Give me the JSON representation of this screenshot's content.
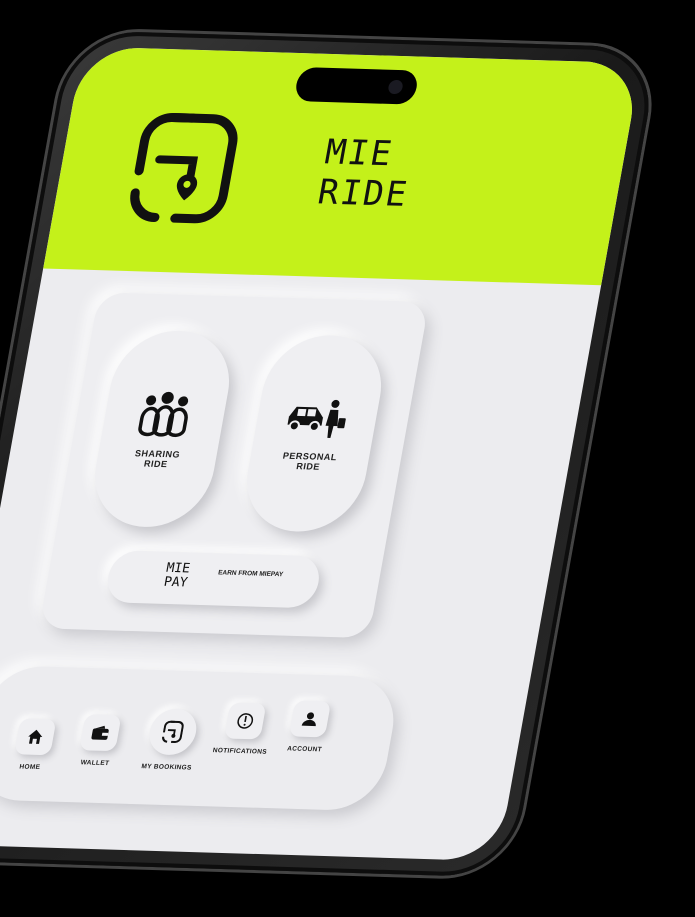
{
  "brand": {
    "line1": "MIE",
    "line2": "RIDE"
  },
  "options": [
    {
      "label": "SHARING\nRIDE",
      "icon": "group-people-icon"
    },
    {
      "label": "PERSONAL\nRIDE",
      "icon": "car-passenger-icon"
    }
  ],
  "pay": {
    "logo_line1": "MIE",
    "logo_line2": "PAY",
    "text": "EARN FROM MIEPAY"
  },
  "nav": [
    {
      "label": "HOME",
      "icon": "home-icon"
    },
    {
      "label": "WALLET",
      "icon": "wallet-icon"
    },
    {
      "label": "MY BOOKINGS",
      "icon": "logo-pin-icon"
    },
    {
      "label": "NOTIFICATIONS",
      "icon": "alert-icon"
    },
    {
      "label": "ACCOUNT",
      "icon": "person-icon"
    }
  ],
  "colors": {
    "accent": "#c4f11a",
    "surface": "#ececef",
    "ink": "#111111"
  }
}
